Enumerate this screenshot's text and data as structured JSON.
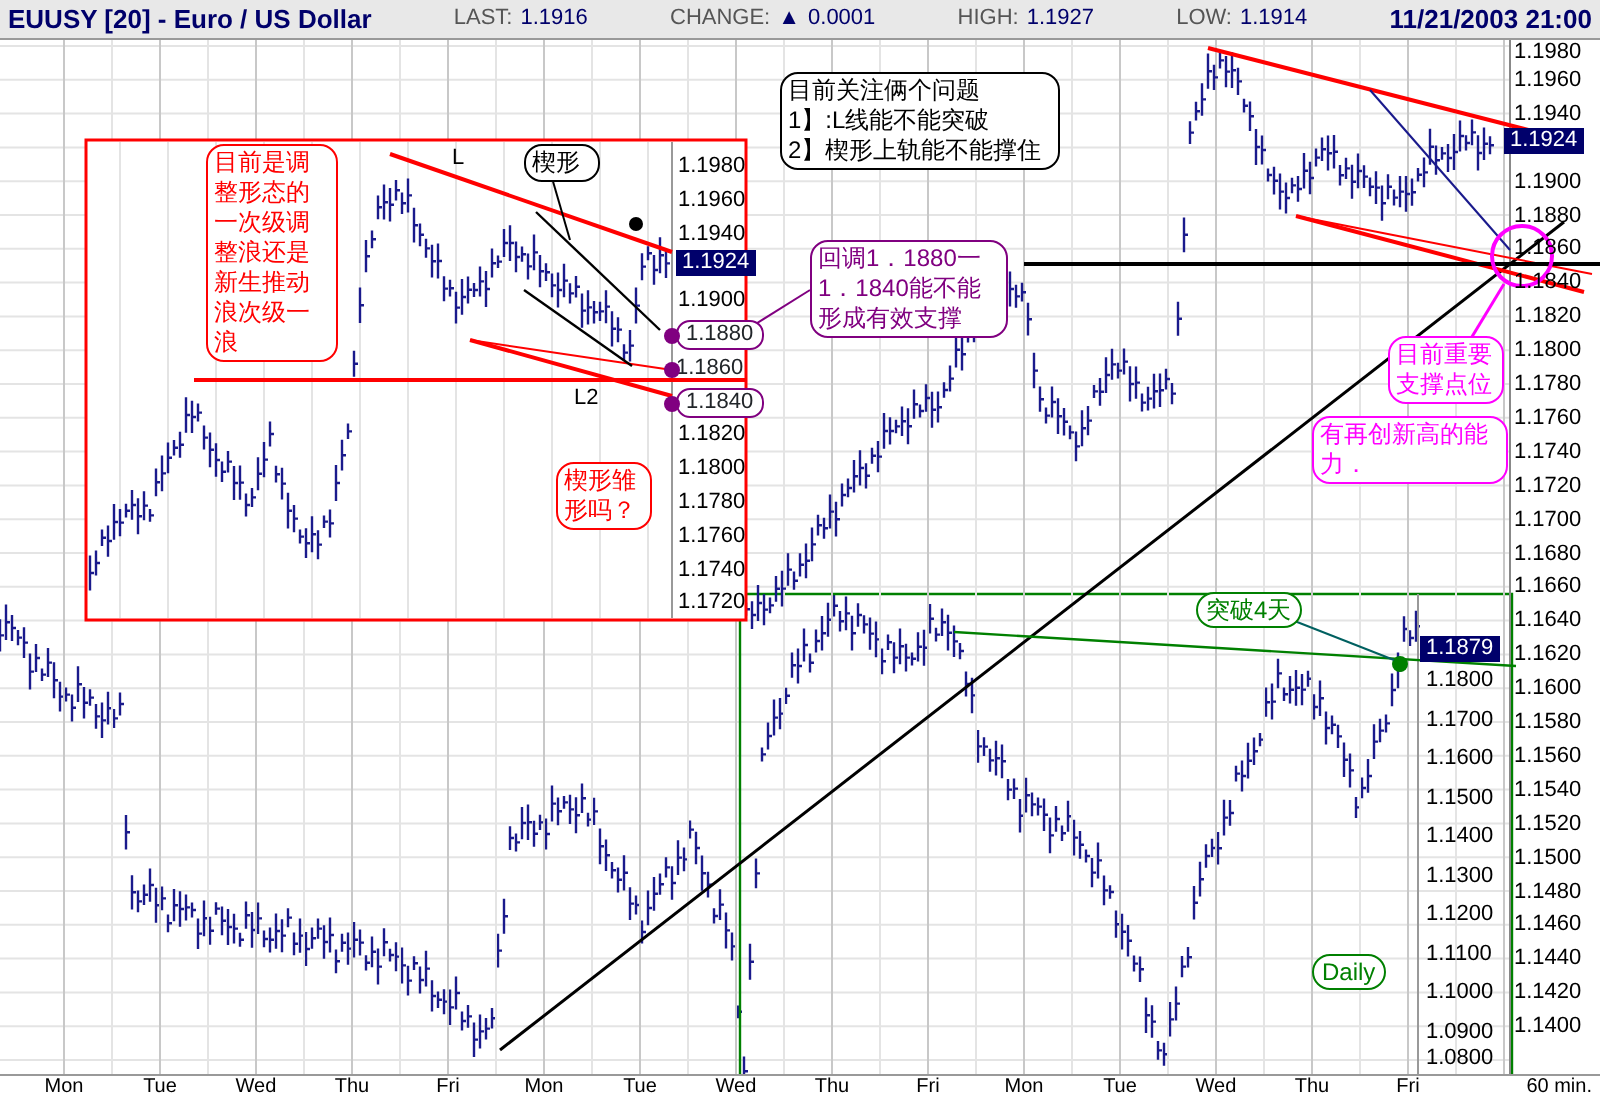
{
  "header": {
    "symbol": "EUUSY [20] - Euro / US Dollar",
    "last_label": "LAST:",
    "last": "1.1916",
    "change_label": "CHANGE:",
    "change_icon": "▲",
    "change": "0.0001",
    "high_label": "HIGH:",
    "high": "1.1927",
    "low_label": "LOW:",
    "low": "1.1914",
    "datetime": "11/21/2003 21:00"
  },
  "price_axis": {
    "ticks": [
      "1.1980",
      "1.1960",
      "1.1940",
      "1.1900",
      "1.1880",
      "1.1860",
      "1.1840",
      "1.1820",
      "1.1800",
      "1.1780",
      "1.1760",
      "1.1740",
      "1.1720",
      "1.1700",
      "1.1680",
      "1.1660",
      "1.1640",
      "1.1620",
      "1.1600",
      "1.1580",
      "1.1560",
      "1.1540",
      "1.1520",
      "1.1500",
      "1.1480",
      "1.1460",
      "1.1440",
      "1.1420",
      "1.1400"
    ],
    "current": "1.1924"
  },
  "inset_panel": {
    "ticks": [
      "1.1980",
      "1.1960",
      "1.1940",
      "1.1900",
      "1.1820",
      "1.1800",
      "1.1780",
      "1.1760",
      "1.1740",
      "1.1720"
    ],
    "markers": [
      {
        "text": "1.1924",
        "kind": "current"
      },
      {
        "text": "1.1880",
        "kind": "circled"
      },
      {
        "text": "1.1860",
        "kind": "plain"
      },
      {
        "text": "1.1840",
        "kind": "circled"
      }
    ],
    "line_labels": [
      "L",
      "L2"
    ]
  },
  "daily_panel": {
    "label": "Daily",
    "note": "突破4天",
    "ticks": [
      "1.1800",
      "1.1700",
      "1.1600",
      "1.1500",
      "1.1400",
      "1.1300",
      "1.1200",
      "1.1100",
      "1.1000",
      "1.0900",
      "1.0800"
    ],
    "current": "1.1879"
  },
  "notes": [
    {
      "lines": [
        "目前关注俩个问题",
        "1】:L线能不能突破",
        "2】楔形上轨能不能撑住"
      ],
      "color": "#000000"
    },
    {
      "lines": [
        "目前是调整形态的一次级调整浪还是新生推动浪次级一浪"
      ],
      "color": "#ff0000"
    },
    {
      "lines": [
        "楔形"
      ],
      "color": "#000000"
    },
    {
      "lines": [
        "回调1．1880一1．1840能不能形成有效支撑"
      ],
      "color": "#800080"
    },
    {
      "lines": [
        "目前重要支撑点位"
      ],
      "color": "#ff00ff"
    },
    {
      "lines": [
        "有再创新高的能力．"
      ],
      "color": "#ff00ff"
    },
    {
      "lines": [
        "楔形雏形吗？"
      ],
      "color": "#ff0000"
    }
  ],
  "x_axis": {
    "days": [
      "Mon",
      "Tue",
      "Wed",
      "Thu",
      "Fri",
      "Mon",
      "Tue",
      "Wed",
      "Thu",
      "Fri",
      "Mon",
      "Tue",
      "Wed",
      "Thu",
      "Fri"
    ],
    "interval": "60 min."
  }
}
